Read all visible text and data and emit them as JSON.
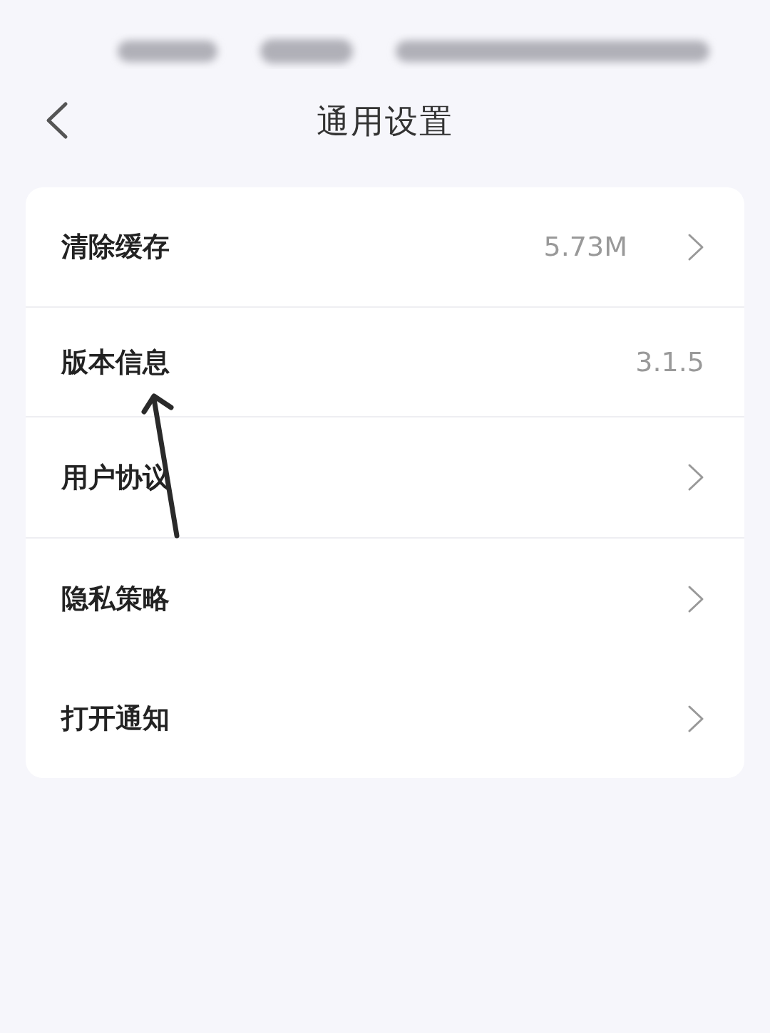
{
  "header": {
    "title": "通用设置"
  },
  "rows": [
    {
      "label": "清除缓存",
      "value": "5.73M",
      "chevron": true,
      "divider": true
    },
    {
      "label": "版本信息",
      "value": "3.1.5",
      "chevron": false,
      "divider": true
    },
    {
      "label": "用户协议",
      "chevron": true,
      "divider": true
    },
    {
      "label": "隐私策略",
      "chevron": true,
      "divider": false
    },
    {
      "label": "打开通知",
      "chevron": true,
      "divider": false
    }
  ]
}
